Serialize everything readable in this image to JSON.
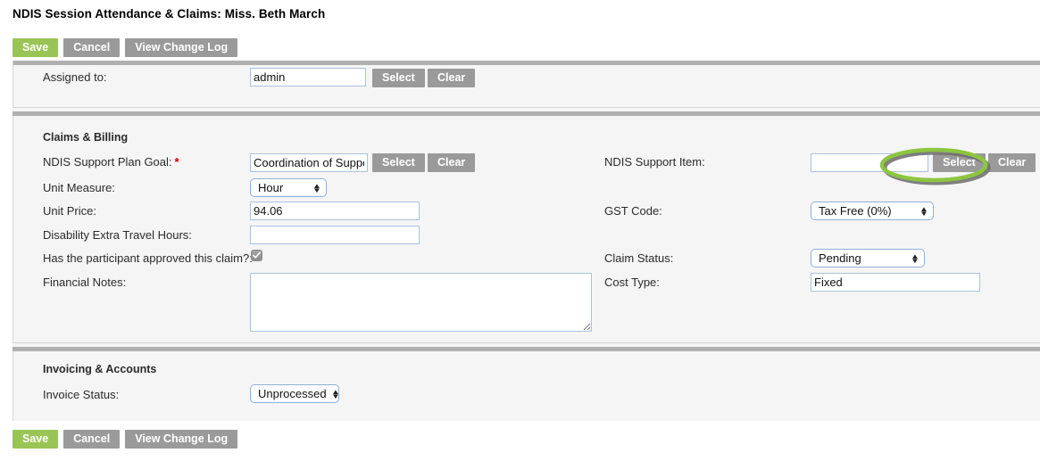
{
  "page": {
    "title": "NDIS Session Attendance & Claims: Miss. Beth March"
  },
  "toolbar": {
    "save_label": "Save",
    "cancel_label": "Cancel",
    "changelog_label": "View Change Log"
  },
  "colors": {
    "save_green": "#9ac455",
    "button_gray": "#9a9a9a",
    "panel_bg": "#f5f5f5",
    "divider_gray": "#b0b0b0",
    "required_red": "#cc0000",
    "highlight_green": "#8cc63f"
  },
  "assigned_section": {
    "label": "Assigned to:",
    "value": "admin",
    "select_label": "Select",
    "clear_label": "Clear"
  },
  "claims_section": {
    "title": "Claims & Billing",
    "support_plan_goal": {
      "label": "NDIS Support Plan Goal:",
      "required_marker": "*",
      "value": "Coordination of Support",
      "select_label": "Select",
      "clear_label": "Clear"
    },
    "unit_measure": {
      "label": "Unit Measure:",
      "value": "Hour"
    },
    "unit_price": {
      "label": "Unit Price:",
      "value": "94.06"
    },
    "travel_hours": {
      "label": "Disability Extra Travel Hours:",
      "value": ""
    },
    "approved": {
      "label": "Has the participant approved this claim?:",
      "checked": "true"
    },
    "financial_notes": {
      "label": "Financial Notes:",
      "value": ""
    },
    "support_item": {
      "label": "NDIS Support Item:",
      "value": "",
      "select_label": "Select",
      "clear_label": "Clear"
    },
    "gst_code": {
      "label": "GST Code:",
      "value": "Tax Free (0%)"
    },
    "claim_status": {
      "label": "Claim Status:",
      "value": "Pending"
    },
    "cost_type": {
      "label": "Cost Type:",
      "value": "Fixed"
    }
  },
  "invoicing_section": {
    "title": "Invoicing & Accounts",
    "invoice_status": {
      "label": "Invoice Status:",
      "value": "Unprocessed"
    }
  },
  "annotation": {
    "target": "support-item-select-button"
  }
}
